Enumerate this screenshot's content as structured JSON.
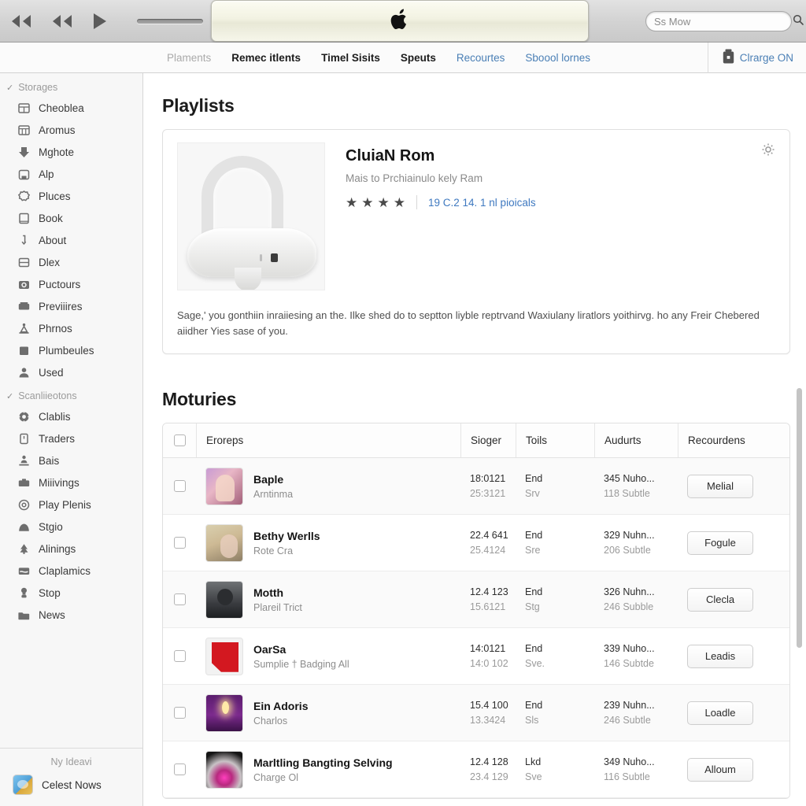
{
  "chrome": {
    "transport": {
      "prev_label": "rewind-start",
      "rew_label": "rewind",
      "play_label": "play"
    },
    "volume_label": "volume",
    "display": {
      "logo": ""
    },
    "search": {
      "placeholder": "Ss Mow",
      "value": "",
      "icon": "search-icon"
    }
  },
  "nav": {
    "tabs": [
      {
        "label": "Plaments",
        "style": "muted"
      },
      {
        "label": "Remec itlents",
        "style": "active"
      },
      {
        "label": "Timel Sisits",
        "style": "active"
      },
      {
        "label": "Speuts",
        "style": "active"
      },
      {
        "label": "Recourtes",
        "style": "link"
      },
      {
        "label": "Sboool lornes",
        "style": "link"
      }
    ],
    "charge": {
      "label": "Clrarge ON",
      "icon": "battery-charge-icon"
    }
  },
  "sidebar": {
    "group1": {
      "label": "Storages",
      "check": "✓"
    },
    "items1": [
      {
        "label": "Cheoblea",
        "icon": "table-icon"
      },
      {
        "label": "Aromus",
        "icon": "grid-icon"
      },
      {
        "label": "Mghote",
        "icon": "download-arrow-icon"
      },
      {
        "label": "Alp",
        "icon": "archive-box-icon"
      },
      {
        "label": "Pluces",
        "icon": "badge-icon"
      },
      {
        "label": "Book",
        "icon": "book-icon"
      },
      {
        "label": "About",
        "icon": "info-arrow-icon"
      },
      {
        "label": "Dlex",
        "icon": "drawer-icon"
      },
      {
        "label": "Puctours",
        "icon": "camera-icon"
      },
      {
        "label": "Previiires",
        "icon": "film-icon"
      },
      {
        "label": "Phrnos",
        "icon": "person-stand-icon"
      },
      {
        "label": "Plumbeules",
        "icon": "square-fill-icon"
      },
      {
        "label": "Used",
        "icon": "user-icon"
      }
    ],
    "group2": {
      "label": "Scanliieotons",
      "check": "✓"
    },
    "items2": [
      {
        "label": "Clablis",
        "icon": "gear-icon"
      },
      {
        "label": "Traders",
        "icon": "bookmark-icon"
      },
      {
        "label": "Bais",
        "icon": "user-stand-icon"
      },
      {
        "label": "Miiivings",
        "icon": "briefcase-icon"
      },
      {
        "label": "Play Plenis",
        "icon": "disc-icon"
      },
      {
        "label": "Stgio",
        "icon": "dome-icon"
      },
      {
        "label": "Alinings",
        "icon": "tree-icon"
      },
      {
        "label": "Claplamics",
        "icon": "card-icon"
      },
      {
        "label": "Stop",
        "icon": "lamp-icon"
      },
      {
        "label": "News",
        "icon": "folder-icon"
      }
    ],
    "footer": {
      "title": "Ny Ideavi",
      "item": "Celest Nows",
      "icon": "media-thumb-icon"
    }
  },
  "main": {
    "playlists_title": "Playlists",
    "hero": {
      "title": "CluiaN Rom",
      "subtitle": "Mais to Prchiainulo kely Ram",
      "stars": 4,
      "link": "19 C.2 14. 1 nl pioicals",
      "gear_icon": "gear-icon",
      "image_alt": "white-headset-product-image",
      "description": "Sage,' you gonthiin inraiiesing an the. Ilke shed do to septton liyble reptrvand Waxiulany liratlors yoithirvg. ho any Freir Chebered aiidher Yies sase of you."
    },
    "motuires_title": "Moturies",
    "table": {
      "columns": [
        "",
        "Eroreps",
        "Sioger",
        "Toils",
        "Audurts",
        "Recourdens"
      ],
      "rows": [
        {
          "name": "Baple",
          "sub": "Arntinma",
          "sioger_top": "18:0121",
          "sioger_bot": "25:3121",
          "toils_top": "End",
          "toils_bot": "Srv",
          "aud_top": "345 Nuho...",
          "aud_bot": "118 Subtle",
          "action": "Melial",
          "art": "a1"
        },
        {
          "name": "Bethy Werlls",
          "sub": "Rote Cra",
          "sioger_top": "22.4 641",
          "sioger_bot": "25.4124",
          "toils_top": "End",
          "toils_bot": "Sre",
          "aud_top": "329 Nuhn...",
          "aud_bot": "206 Subtle",
          "action": "Fogule",
          "art": "a2"
        },
        {
          "name": "Motth",
          "sub": "Plareil Trict",
          "sioger_top": "12.4 123",
          "sioger_bot": "15.6121",
          "toils_top": "End",
          "toils_bot": "Stg",
          "aud_top": "326 Nuhn...",
          "aud_bot": "246 Subble",
          "action": "Clecla",
          "art": "a3"
        },
        {
          "name": "OarSa",
          "sub": "Sumplie † Badging All",
          "sioger_top": "14:0121",
          "sioger_bot": "14:0 102",
          "toils_top": "End",
          "toils_bot": "Sve.",
          "aud_top": "339 Nuho...",
          "aud_bot": "146 Subtde",
          "action": "Leadis",
          "art": "a4"
        },
        {
          "name": "Ein Adoris",
          "sub": "Charlos",
          "sioger_top": "15.4 100",
          "sioger_bot": "13.3424",
          "toils_top": "End",
          "toils_bot": "Sls",
          "aud_top": "239 Nuhn...",
          "aud_bot": "246 Subtle",
          "action": "Loadle",
          "art": "a5"
        },
        {
          "name": "Marltling Bangting Selving",
          "sub": "Charge Ol",
          "sioger_top": "12.4 128",
          "sioger_bot": "23.4 129",
          "toils_top": "Lkd",
          "toils_bot": "Sve",
          "aud_top": "349 Nuho...",
          "aud_bot": "116 Subtle",
          "action": "Alloum",
          "art": "a6"
        }
      ]
    }
  },
  "colors": {
    "link": "#3f79c0",
    "chrome": "#d3d3d3",
    "sidebar": "#f7f7f7",
    "lcd": "#f2f2e2"
  }
}
